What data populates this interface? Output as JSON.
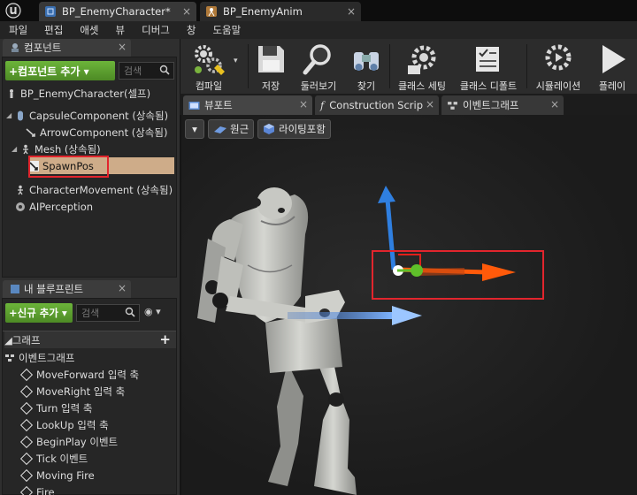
{
  "document_tabs": [
    {
      "label": "BP_EnemyCharacter*",
      "close": "×",
      "active": true
    },
    {
      "label": "BP_EnemyAnim",
      "close": "×",
      "active": false
    }
  ],
  "menu": [
    "파일",
    "편집",
    "애셋",
    "뷰",
    "디버그",
    "창",
    "도움말"
  ],
  "components_panel": {
    "tab_label": "컴포넌트",
    "close": "×",
    "add_button": "+컴포넌트 추가 ▾",
    "search_placeholder": "검색",
    "self_item": "BP_EnemyCharacter(셀프)",
    "items": [
      {
        "label": "CapsuleComponent (상속됨)",
        "icon": "capsule-icon"
      },
      {
        "label": "ArrowComponent (상속됨)",
        "icon": "arrow-component-icon"
      },
      {
        "label": "Mesh (상속됨)",
        "icon": "mesh-icon",
        "expander": "◢"
      },
      {
        "label": "SpawnPos",
        "icon": "arrow-component-icon",
        "selected": true
      },
      {
        "label": "CharacterMovement (상속됨)",
        "icon": "movement-icon"
      },
      {
        "label": "AIPerception",
        "icon": "perception-icon"
      }
    ]
  },
  "blueprint_panel": {
    "tab_label": "내 블루프린트",
    "close": "×",
    "new_button": "+신규 추가 ▾",
    "search_placeholder": "검색",
    "eye": "◉ ▾",
    "graph_section": "◢그래프",
    "add_symbol": "+",
    "event_graph": "이벤트그래프",
    "events": [
      "MoveForward 입력 축",
      "MoveRight 입력 축",
      "Turn 입력 축",
      "LookUp 입력 축",
      "BeginPlay 이벤트",
      "Tick 이벤트",
      "Moving Fire",
      "Fire"
    ]
  },
  "toolbar": {
    "compile": "컴파일",
    "save": "저장",
    "browse": "둘러보기",
    "find": "찾기",
    "class_settings": "클래스 세팅",
    "class_defaults": "클래스 디폴트",
    "simulation": "시뮬레이션",
    "play": "플레이"
  },
  "editor_tabs": [
    {
      "label": "뷰포트",
      "close": "×"
    },
    {
      "label": "Construction Scrip",
      "close": "×"
    },
    {
      "label": "이벤트그래프",
      "close": "×"
    }
  ],
  "viewport": {
    "menu_glyph": "▾",
    "perspective": "원근",
    "lighting": "라이팅포함"
  },
  "colors": {
    "accent_green": "#5fa52f",
    "selection": "#ceac89",
    "highlight_box": "#e2252d",
    "gizmo_x": "#ff5a0a",
    "gizmo_z": "#2f7fe0",
    "gizmo_y": "#5fbf2a"
  }
}
